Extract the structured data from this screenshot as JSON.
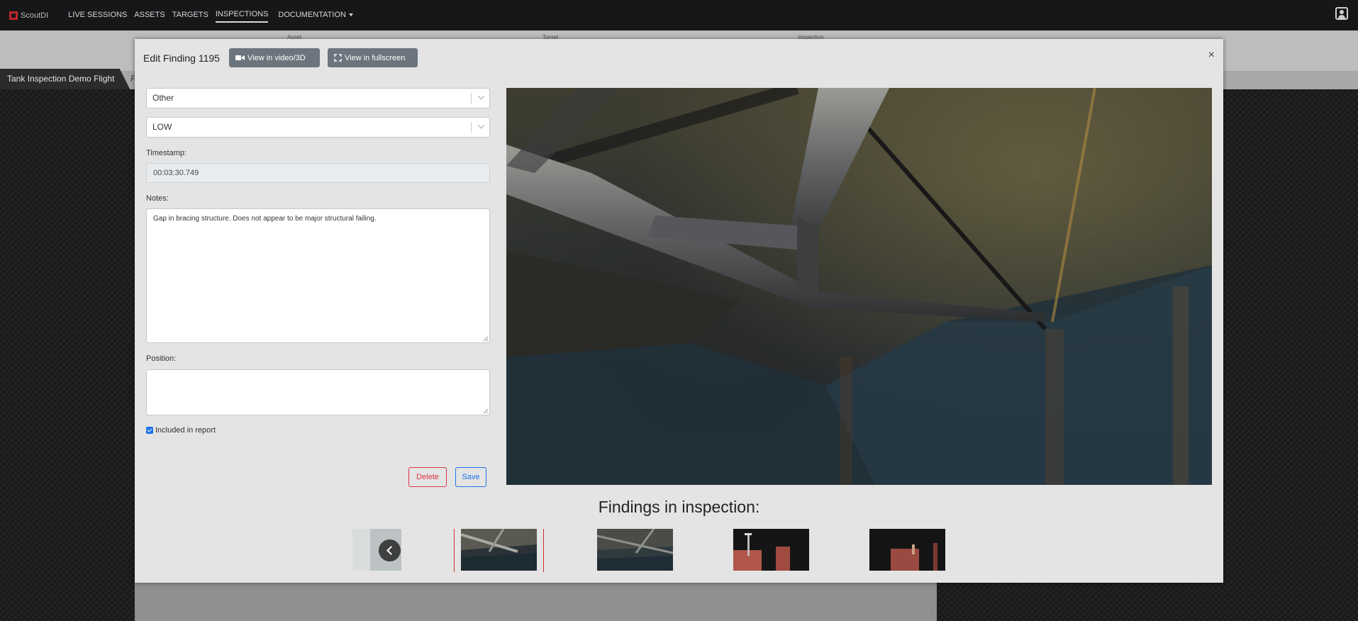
{
  "navbar": {
    "brand": "ScoutDI",
    "items": [
      {
        "label": "LIVE SESSIONS"
      },
      {
        "label": "ASSETS"
      },
      {
        "label": "TARGETS"
      },
      {
        "label": "INSPECTIONS",
        "active": true
      },
      {
        "label": "DOCUMENTATION"
      }
    ]
  },
  "background_page": {
    "header_labels": [
      "Asset",
      "Target",
      "Inspection"
    ],
    "tab_label": "Tank Inspection Demo Flight",
    "tab2_label": "F"
  },
  "modal": {
    "title": "Edit Finding 1195",
    "view_video_label": "View in video/3D",
    "view_fullscreen_label": "View in fullscreen",
    "close_label": "×",
    "type_select": {
      "value": "Other"
    },
    "severity_select": {
      "value": "LOW"
    },
    "timestamp": {
      "label": "Timestamp:",
      "value": "00:03:30.749"
    },
    "notes": {
      "label": "Notes:",
      "value": "Gap in bracing structure. Does not appear to be major structural failing."
    },
    "position": {
      "label": "Position:",
      "value": ""
    },
    "included_in_report": {
      "label": "Included in report",
      "checked": true
    },
    "delete_label": "Delete",
    "save_label": "Save",
    "findings_title": "Findings in inspection:"
  },
  "colors": {
    "navbar": "#151719",
    "modal_bg": "#e4e4e4",
    "danger": "#dc3545",
    "primary": "#1a73e8",
    "selected_thumb_border": "#d32f2f"
  }
}
